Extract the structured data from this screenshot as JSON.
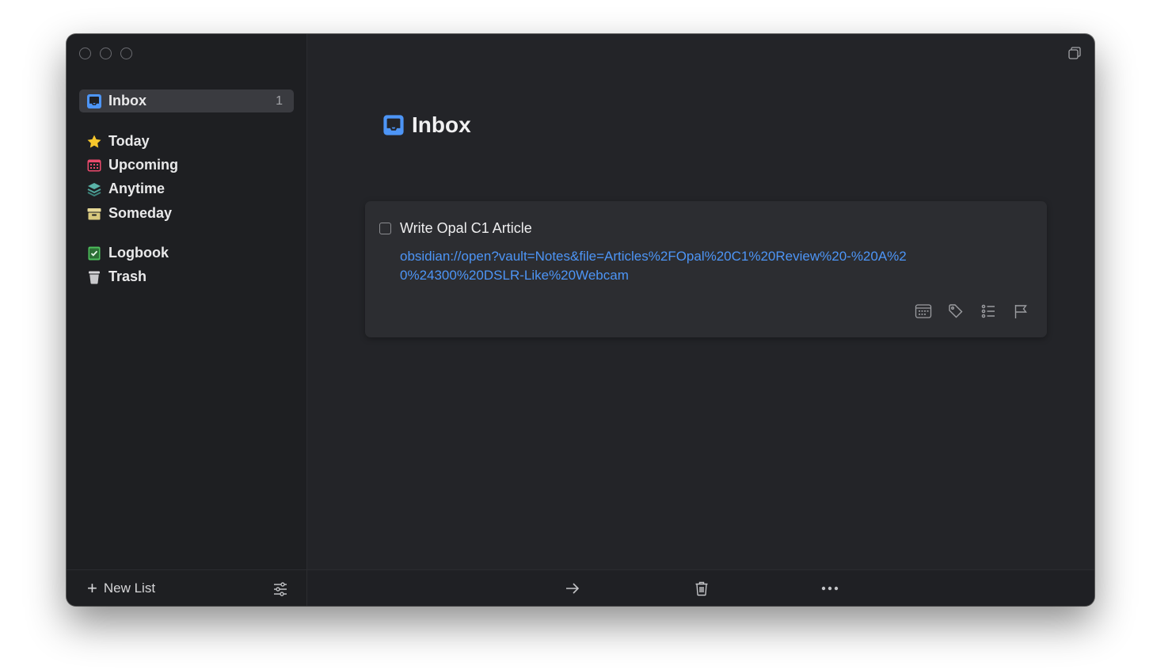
{
  "sidebar": {
    "inbox": {
      "label": "Inbox",
      "count": "1",
      "icon": "inbox-icon"
    },
    "groups": [
      [
        {
          "label": "Today",
          "icon": "star-icon",
          "color": "#f7c72c"
        },
        {
          "label": "Upcoming",
          "icon": "calendar-icon",
          "color": "#e94a6c"
        },
        {
          "label": "Anytime",
          "icon": "layers-icon",
          "color": "#4fa49a"
        },
        {
          "label": "Someday",
          "icon": "archive-box-icon",
          "color": "#e6d896"
        }
      ],
      [
        {
          "label": "Logbook",
          "icon": "logbook-icon",
          "color": "#4dbf5c"
        },
        {
          "label": "Trash",
          "icon": "trash-icon",
          "color": "#c9c9cc"
        }
      ]
    ],
    "footer": {
      "new_list_label": "New List",
      "new_list_icon": "plus-icon",
      "filter_icon": "sliders-icon"
    }
  },
  "main": {
    "title": "Inbox",
    "title_icon": "inbox-icon",
    "accent_color": "#4d95f6",
    "task": {
      "title": "Write Opal C1 Article",
      "notes": "obsidian://open?vault=Notes&file=Articles%2FOpal%20C1%20Review%20-%20A%20%24300%20DSLR-Like%20Webcam",
      "completed": false,
      "actions": [
        "calendar-icon",
        "tag-icon",
        "checklist-icon",
        "flag-icon"
      ]
    },
    "toolbar": [
      "move-arrow-icon",
      "trash-icon",
      "more-icon"
    ]
  }
}
